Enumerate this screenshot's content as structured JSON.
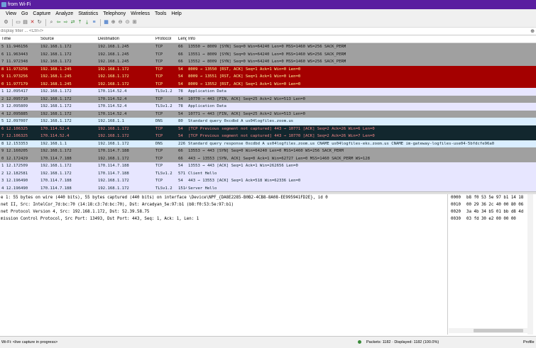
{
  "window": {
    "title": "from Wi-Fi"
  },
  "menu": [
    "View",
    "Go",
    "Capture",
    "Analyze",
    "Statistics",
    "Telephony",
    "Wireless",
    "Tools",
    "Help"
  ],
  "filter": {
    "placeholder": "display filter ... <Ctrl-/>"
  },
  "columns": [
    "Time",
    "Source",
    "Destination",
    "Protocol",
    "Length",
    "Info"
  ],
  "packets": [
    {
      "no": "5",
      "time": "11.946156",
      "src": "192.168.1.172",
      "dst": "192.168.1.245",
      "proto": "TCP",
      "len": "66",
      "info": "13550 → 8009 [SYN] Seq=0 Win=64240 Len=0 MSS=1460 WS=256 SACK_PERM",
      "color": "gray"
    },
    {
      "no": "6",
      "time": "11.963443",
      "src": "192.168.1.172",
      "dst": "192.168.1.245",
      "proto": "TCP",
      "len": "66",
      "info": "13551 → 8009 [SYN] Seq=0 Win=64240 Len=0 MSS=1460 WS=256 SACK_PERM",
      "color": "gray"
    },
    {
      "no": "7",
      "time": "11.972348",
      "src": "192.168.1.172",
      "dst": "192.168.1.245",
      "proto": "TCP",
      "len": "66",
      "info": "13552 → 8009 [SYN] Seq=0 Win=64240 Len=0 MSS=1460 WS=256 SACK_PERM",
      "color": "gray"
    },
    {
      "no": "8",
      "time": "11.973256",
      "src": "192.168.1.245",
      "dst": "192.168.1.172",
      "proto": "TCP",
      "len": "54",
      "info": "8009 → 13550 [RST, ACK] Seq=1 Ack=1 Win=0 Len=0",
      "color": "red"
    },
    {
      "no": "9",
      "time": "11.973256",
      "src": "192.168.1.245",
      "dst": "192.168.1.172",
      "proto": "TCP",
      "len": "54",
      "info": "8009 → 13551 [RST, ACK] Seq=1 Ack=1 Win=0 Len=0",
      "color": "red"
    },
    {
      "no": "0",
      "time": "11.977179",
      "src": "192.168.1.245",
      "dst": "192.168.1.172",
      "proto": "TCP",
      "len": "54",
      "info": "8009 → 13552 [RST, ACK] Seq=1 Ack=1 Win=0 Len=0",
      "color": "red"
    },
    {
      "no": "1",
      "time": "12.095417",
      "src": "192.168.1.172",
      "dst": "170.114.52.4",
      "proto": "TLSv1.2",
      "len": "78",
      "info": "Application Data",
      "color": "lav"
    },
    {
      "no": "2",
      "time": "12.095710",
      "src": "192.168.1.172",
      "dst": "170.114.52.4",
      "proto": "TCP",
      "len": "54",
      "info": "10770 → 443 [FIN, ACK] Seq=25 Ack=2 Win=513 Len=0",
      "color": "gray"
    },
    {
      "no": "3",
      "time": "12.095809",
      "src": "192.168.1.172",
      "dst": "170.114.52.4",
      "proto": "TLSv1.2",
      "len": "78",
      "info": "Application Data",
      "color": "lav"
    },
    {
      "no": "4",
      "time": "12.095885",
      "src": "192.168.1.172",
      "dst": "170.114.52.4",
      "proto": "TCP",
      "len": "54",
      "info": "10771 → 443 [FIN, ACK] Seq=25 Ack=2 Win=513 Len=0",
      "color": "gray"
    },
    {
      "no": "5",
      "time": "12.097007",
      "src": "192.168.1.172",
      "dst": "192.168.1.1",
      "proto": "DNS",
      "len": "80",
      "info": "Standard query 0xcdbd A us04logfiles.zoom.us",
      "color": "blue"
    },
    {
      "no": "6",
      "time": "12.106325",
      "src": "170.114.52.4",
      "dst": "192.168.1.172",
      "proto": "TCP",
      "len": "54",
      "info": "[TCP Previous segment not captured] 443 → 10771 [ACK] Seq=2 Ack=26 Win=6 Len=0",
      "color": "dark"
    },
    {
      "no": "7",
      "time": "12.106325",
      "src": "170.114.52.4",
      "dst": "192.168.1.172",
      "proto": "TCP",
      "len": "54",
      "info": "[TCP Previous segment not captured] 443 → 10770 [ACK] Seq=2 Ack=26 Win=7 Len=0",
      "color": "dark"
    },
    {
      "no": "8",
      "time": "12.153353",
      "src": "192.168.1.1",
      "dst": "192.168.1.172",
      "proto": "DNS",
      "len": "226",
      "info": "Standard query response 0xcdbd A us04logfiles.zoom.us CNAME us04logfiles-eks.zoom.us CNAME im-gateway-logfiles-use04-5bfdcfe96a0",
      "color": "blue"
    },
    {
      "no": "9",
      "time": "12.160205",
      "src": "192.168.1.172",
      "dst": "170.114.7.188",
      "proto": "TCP",
      "len": "66",
      "info": "13553 → 443 [SYN] Seq=0 Win=64240 Len=0 MSS=1460 WS=256 SACK_PERM",
      "color": "gray"
    },
    {
      "no": "0",
      "time": "12.172429",
      "src": "170.114.7.188",
      "dst": "192.168.1.172",
      "proto": "TCP",
      "len": "66",
      "info": "443 → 13553 [SYN, ACK] Seq=0 Ack=1 Win=62727 Len=0 MSS=1460 SACK_PERM WS=128",
      "color": "gray"
    },
    {
      "no": "1",
      "time": "12.172509",
      "src": "192.168.1.172",
      "dst": "170.114.7.188",
      "proto": "TCP",
      "len": "54",
      "info": "13553 → 443 [ACK] Seq=1 Ack=1 Win=262656 Len=0",
      "color": "lav"
    },
    {
      "no": "2",
      "time": "12.182581",
      "src": "192.168.1.172",
      "dst": "170.114.7.188",
      "proto": "TLSv1.2",
      "len": "571",
      "info": "Client Hello",
      "color": "lav"
    },
    {
      "no": "3",
      "time": "12.196490",
      "src": "170.114.7.188",
      "dst": "192.168.1.172",
      "proto": "TCP",
      "len": "54",
      "info": "443 → 13553 [ACK] Seq=1 Ack=518 Win=62336 Len=0",
      "color": "lav"
    },
    {
      "no": "4",
      "time": "12.196490",
      "src": "170.114.7.188",
      "dst": "192.168.1.172",
      "proto": "TLSv1.2",
      "len": "1514",
      "info": "Server Hello",
      "color": "lav"
    }
  ],
  "details": [
    "e 1: 55 bytes on wire (440 bits), 55 bytes captured (440 bits) on interface \\Device\\NPF_{DA8E2285-B0B2-4CB8-8A08-EE995941FD2E}, id 0",
    "net II, Src: IntelCor_7d:bc:70 (14:18:c3:7d:bc:70), Dst: Arcadyan_5e:97:b1 (b8:f0:53:5e:97:b1)",
    "net Protocol Version 4, Src: 192.168.1.172, Dst: 52.39.58.75",
    "mission Control Protocol, Src Port: 13493, Dst Port: 443, Seq: 1, Ack: 1, Len: 1"
  ],
  "bytes": [
    {
      "offset": "0000",
      "hex": "b8 f0 53 5e 97 b1 14 18"
    },
    {
      "offset": "0010",
      "hex": "00 29 36 2c 40 00 80 06"
    },
    {
      "offset": "0020",
      "hex": "3a 4b 34 b5 01 bb d8 4d"
    },
    {
      "offset": "0030",
      "hex": "03 fd 30 e2 00 00 00"
    }
  ],
  "status": {
    "left": "Wi-Fi: <live capture in progress>",
    "packets": "Packets: 1182 · Displayed: 1182 (100.0%)",
    "profile": "Profile"
  }
}
